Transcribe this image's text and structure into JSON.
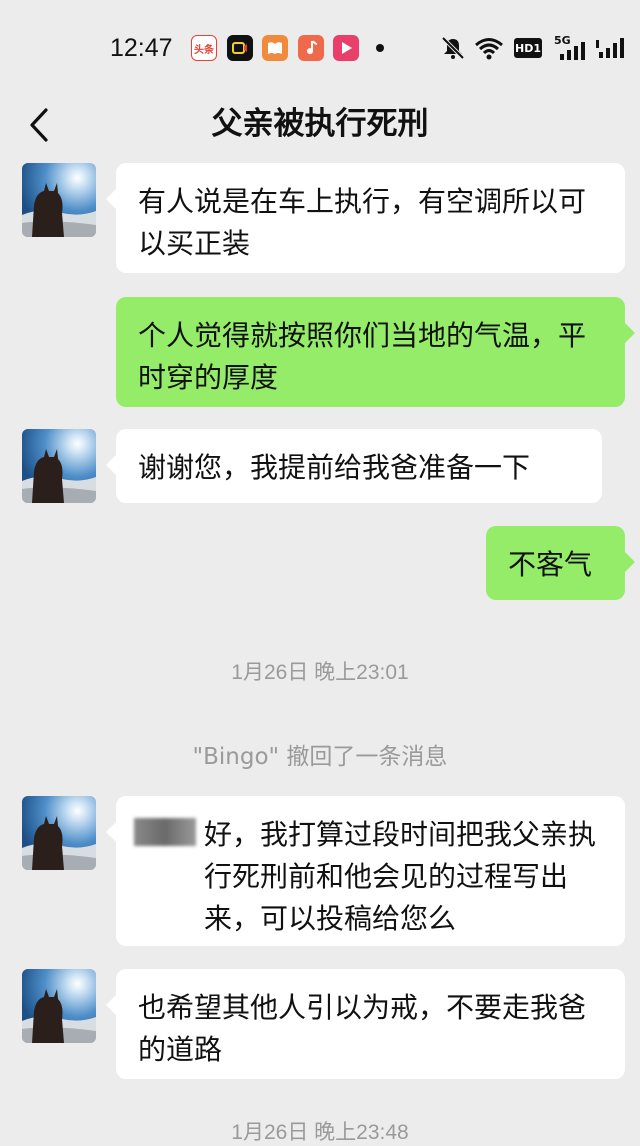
{
  "status_bar": {
    "time": "12:47",
    "app_icons": [
      {
        "name": "toutiao-icon",
        "label": "头条",
        "color": "#e8403a"
      },
      {
        "name": "video-icon",
        "label": "",
        "color": "#111111"
      },
      {
        "name": "book-icon",
        "label": "",
        "color": "#f08a3c"
      },
      {
        "name": "music-icon",
        "label": "",
        "color": "#ef6a4b"
      },
      {
        "name": "play-icon",
        "label": "",
        "color": "#e8406a"
      }
    ],
    "system_icons": [
      "mute-icon",
      "wifi-icon",
      "hd-icon",
      "5g-signal-icon",
      "signal-icon"
    ],
    "hd_label": "HD1",
    "network_label": "5G"
  },
  "header": {
    "title": "父亲被执行死刑"
  },
  "messages": [
    {
      "type": "in",
      "text": "有人说是在车上执行，有空调所以可以买正装"
    },
    {
      "type": "out",
      "text": "个人觉得就按照你们当地的气温，平时穿的厚度"
    },
    {
      "type": "in",
      "text": "谢谢您，我提前给我爸准备一下"
    },
    {
      "type": "out",
      "text": "不客气"
    },
    {
      "type": "time",
      "text": "1月26日 晚上23:01"
    },
    {
      "type": "system",
      "text": "\"Bingo\" 撤回了一条消息"
    },
    {
      "type": "in",
      "text": "好，我打算过段时间把我父亲执行死刑前和他会见的过程写出来，可以投稿给您么"
    },
    {
      "type": "in",
      "text": "也希望其他人引以为戒，不要走我爸的道路"
    },
    {
      "type": "time",
      "text": "1月26日 晚上23:48"
    }
  ],
  "colors": {
    "background": "#ececec",
    "incoming_bubble": "#ffffff",
    "outgoing_bubble": "#95ec69",
    "meta_text": "#9a9a9a"
  }
}
